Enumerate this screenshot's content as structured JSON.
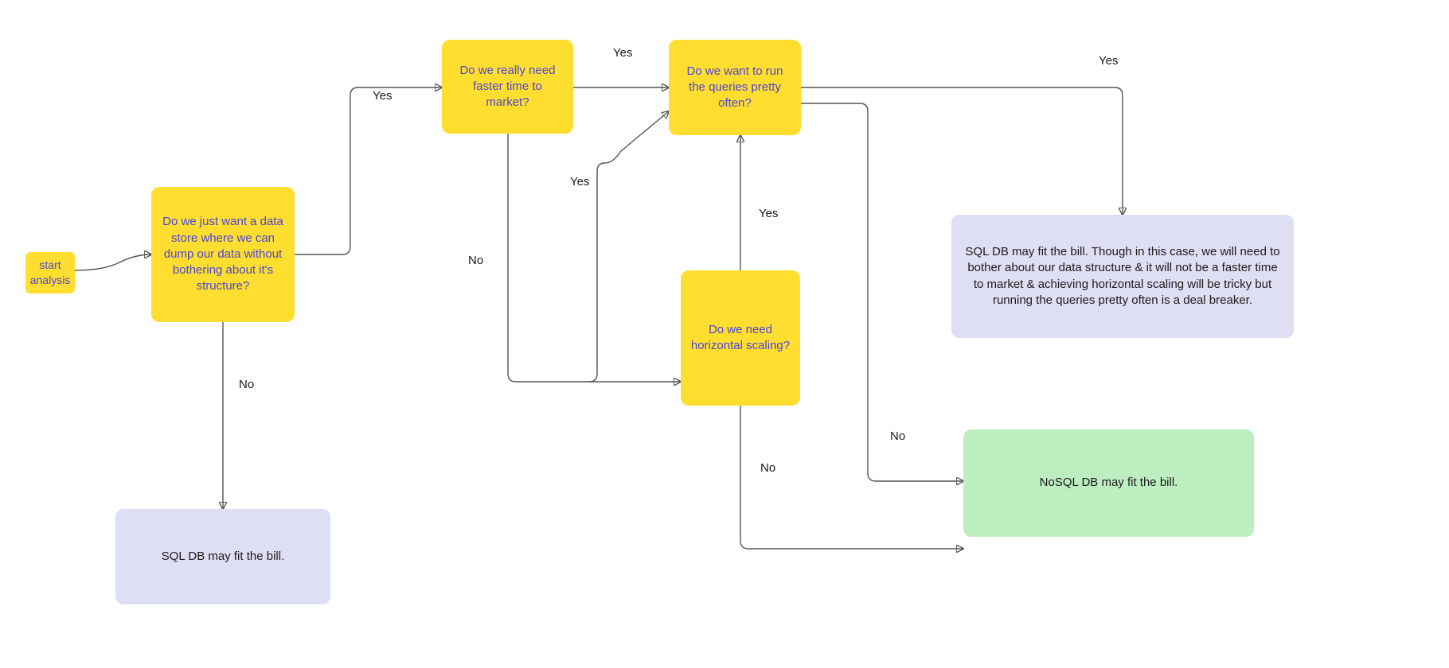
{
  "nodes": {
    "start": {
      "text": "start analysis"
    },
    "dump": {
      "text": "Do we just want a data store where we can dump our data without bothering about it's structure?"
    },
    "faster": {
      "text": "Do we really need faster time to market?"
    },
    "queries": {
      "text": "Do we want to run the queries pretty often?"
    },
    "scaling": {
      "text": "Do we need horizontal scaling?"
    },
    "sql_simple": {
      "text": "SQL DB may fit the bill."
    },
    "sql_long": {
      "text": "SQL DB may fit the bill. Though in this case, we will need to bother about our data structure & it will not be a faster time to market & achieving horizontal scaling will be tricky but running the queries pretty often is a deal breaker."
    },
    "nosql": {
      "text": "NoSQL DB may fit the bill."
    }
  },
  "labels": {
    "dump_yes": "Yes",
    "dump_no": "No",
    "faster_yes": "Yes",
    "faster_no": "No",
    "scaling_yes_top": "Yes",
    "scaling_yes_mid": "Yes",
    "scaling_no": "No",
    "queries_yes": "Yes",
    "queries_no": "No"
  },
  "colors": {
    "yellow": "#ffde30",
    "yellow_text": "#4a45d8",
    "lavender": "#dfdff4",
    "green": "#bdeec0",
    "arrow": "#555555"
  }
}
